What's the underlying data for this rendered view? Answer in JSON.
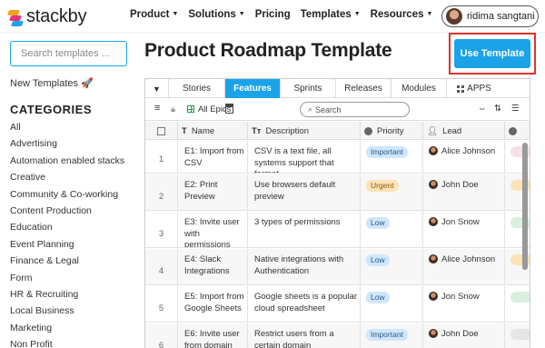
{
  "brand": {
    "name": "stackby"
  },
  "nav": {
    "links": [
      {
        "label": "Product",
        "caret": true
      },
      {
        "label": "Solutions",
        "caret": true
      },
      {
        "label": "Pricing",
        "caret": false
      },
      {
        "label": "Templates",
        "caret": true
      },
      {
        "label": "Resources",
        "caret": true
      }
    ],
    "user": "ridima sangtani"
  },
  "sidebar": {
    "search_placeholder": "Search templates ...",
    "new_templates": "New Templates 🚀",
    "categories_title": "CATEGORIES",
    "categories": [
      "All",
      "Advertising",
      "Automation enabled stacks",
      "Creative",
      "Community & Co-working",
      "Content Production",
      "Education",
      "Event Planning",
      "Finance & Legal",
      "Form",
      "HR & Recruiting",
      "Local Business",
      "Marketing",
      "Non Profit"
    ]
  },
  "page": {
    "title": "Product Roadmap Template",
    "cta": "Use Template"
  },
  "app": {
    "tabs": [
      "Stories",
      "Features",
      "Sprints",
      "Releases",
      "Modules",
      "APPS"
    ],
    "active_tab": "Features",
    "toolbar": {
      "filter_label": "All Epics",
      "search_placeholder": "Search"
    },
    "columns": {
      "name": "Name",
      "name_type_glyph": "T",
      "description": "Description",
      "description_type_glyph": "Tт",
      "priority": "Priority",
      "lead": "Lead"
    },
    "rows": [
      {
        "num": "1",
        "name": "E1: Import from CSV",
        "desc": "CSV is a text file, all systems support that format",
        "priority": "Important",
        "lead": "Alice Johnson"
      },
      {
        "num": "2",
        "name": "E2: Print Preview",
        "desc": "Use browsers default preview",
        "priority": "Urgent",
        "lead": "John Doe"
      },
      {
        "num": "3",
        "name": "E3: Invite user with permissions",
        "desc": "3 types of permissions",
        "priority": "Low",
        "lead": "Jon Snow"
      },
      {
        "num": "4",
        "name": "E4: Slack Integrations",
        "desc": "Native integrations with Authentication",
        "priority": "Low",
        "lead": "Alice Johnson"
      },
      {
        "num": "5",
        "name": "E5: Import from Google Sheets",
        "desc": "Google sheets is a popular cloud spreadsheet",
        "priority": "Low",
        "lead": "Jon Snow"
      },
      {
        "num": "6",
        "name": "E6: Invite user from domain",
        "desc": "Restrict users from a certain domain",
        "priority": "Important",
        "lead": "John Doe"
      }
    ]
  },
  "colors": {
    "accent": "#1aa3e8",
    "highlight": "#e0332b"
  }
}
